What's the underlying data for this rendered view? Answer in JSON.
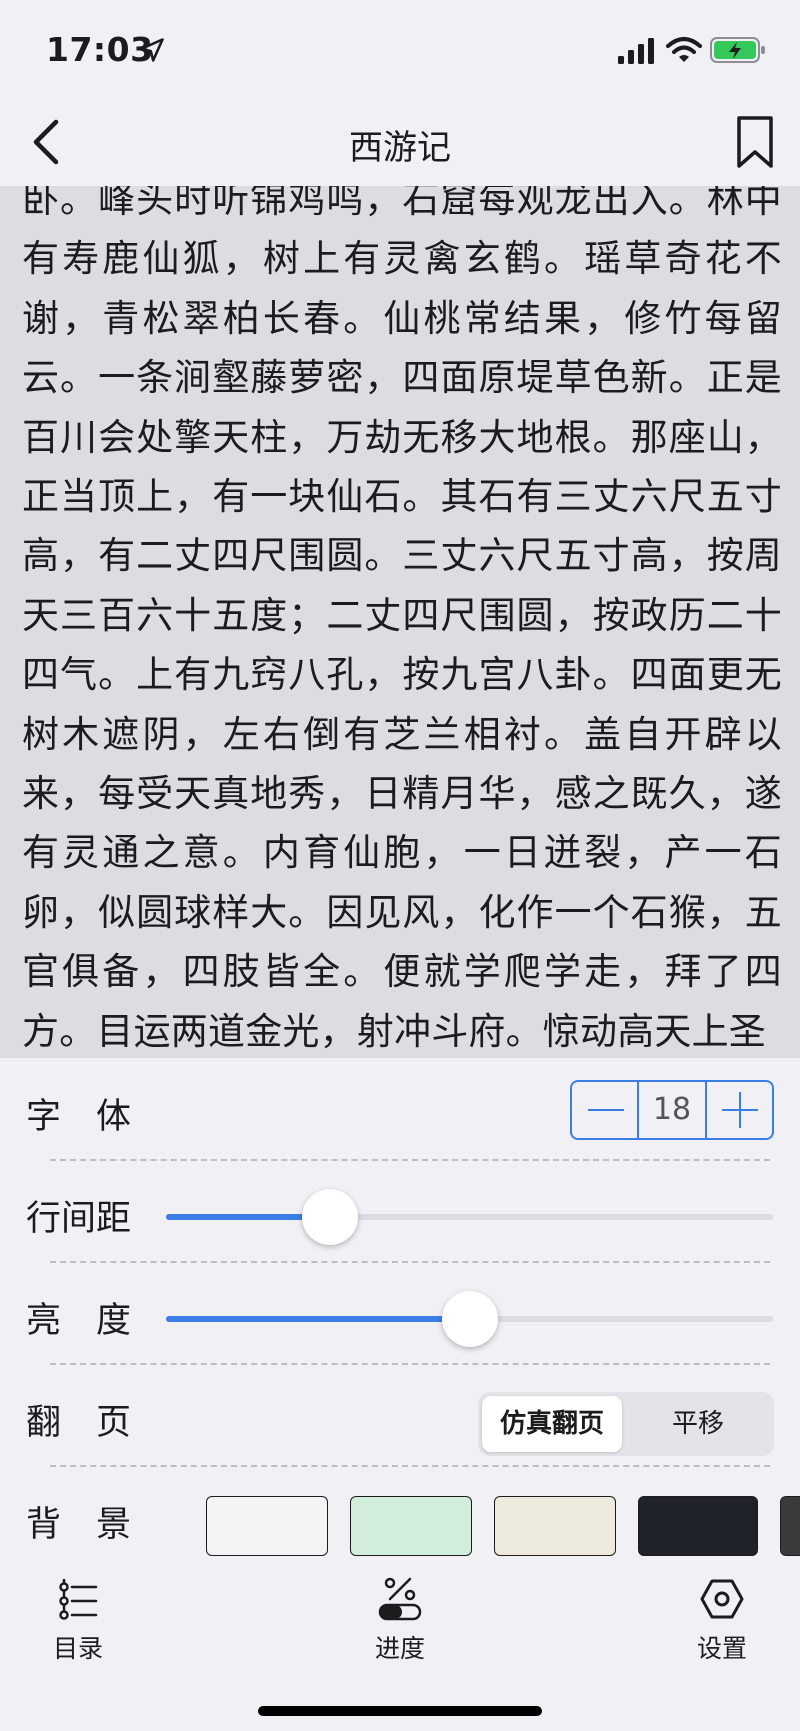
{
  "status_bar": {
    "time": "17:03",
    "icons": [
      "location-arrow-icon",
      "cellular-signal-icon",
      "wifi-icon",
      "battery-charging-icon"
    ],
    "battery_color": "#34c759"
  },
  "nav": {
    "title": "西游记",
    "back_icon": "chevron-left-icon",
    "bookmark_icon": "bookmark-icon"
  },
  "reading": {
    "text": "卧。峰头时听锦鸡鸣，石窟每观龙出入。林中有寿鹿仙狐，树上有灵禽玄鹤。瑶草奇花不谢，青松翠柏长春。仙桃常结果，修竹每留云。一条涧壑藤萝密，四面原堤草色新。正是百川会处擎天柱，万劫无移大地根。那座山，正当顶上，有一块仙石。其石有三丈六尺五寸高，有二丈四尺围圆。三丈六尺五寸高，按周天三百六十五度；二丈四尺围圆，按政历二十四气。上有九窍八孔，按九宫八卦。四面更无树木遮阴，左右倒有芝兰相衬。盖自开辟以来，每受天真地秀，日精月华，感之既久，遂有灵通之意。内育仙胞，一日迸裂，产一石卵，似圆球样大。因见风，化作一个石猴，五官俱备，四肢皆全。便就学爬学走，拜了四方。目运两道金光，射冲斗府。惊动高天上圣"
  },
  "settings": {
    "font": {
      "label": "字　体",
      "value": "18"
    },
    "line_spacing": {
      "label": "行间距",
      "level": 0.27
    },
    "brightness": {
      "label": "亮　度",
      "level": 0.5
    },
    "page_turn": {
      "label": "翻　页",
      "options": [
        "仿真翻页",
        "平移"
      ],
      "selected": "仿真翻页"
    },
    "background": {
      "label": "背　景",
      "swatches": [
        "#f4f4f4",
        "#d3eddb",
        "#eeeadd",
        "#1f2228",
        "#3a3a3a"
      ]
    },
    "accent_color": "#3a7ee5"
  },
  "tab_bar": {
    "items": [
      {
        "label": "目录",
        "icon": "table-of-contents-icon"
      },
      {
        "label": "进度",
        "icon": "progress-icon"
      },
      {
        "label": "设置",
        "icon": "settings-hexagon-icon"
      }
    ]
  }
}
